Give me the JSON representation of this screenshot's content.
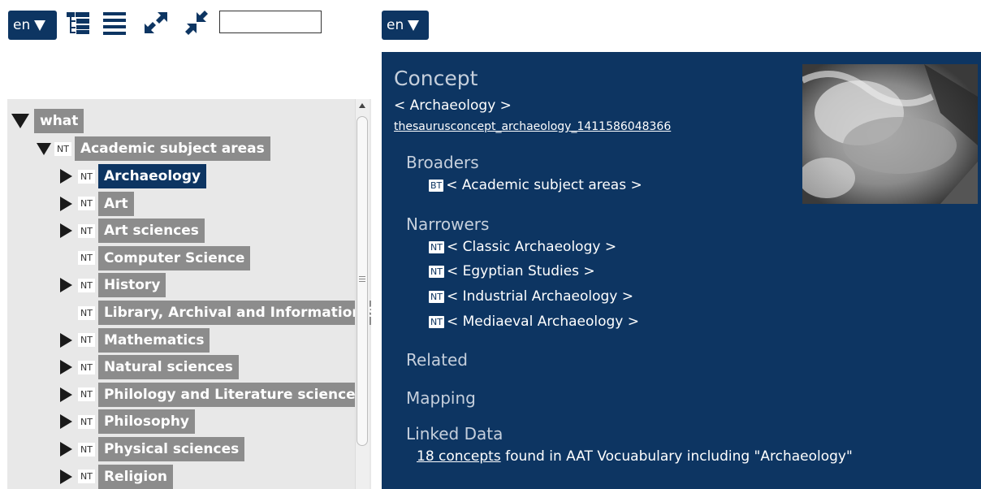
{
  "left_toolbar": {
    "lang": "en",
    "icons": [
      "tree-view-icon",
      "list-view-icon",
      "expand-all-icon",
      "collapse-all-icon"
    ],
    "search": {
      "value": "",
      "placeholder": ""
    }
  },
  "right_toolbar": {
    "lang": "en"
  },
  "tree": {
    "root": "what",
    "level1": {
      "tag": "NT",
      "label": "Academic subject areas"
    },
    "items": [
      {
        "tag": "NT",
        "label": "Archaeology",
        "expandable": true,
        "selected": true
      },
      {
        "tag": "NT",
        "label": "Art",
        "expandable": true
      },
      {
        "tag": "NT",
        "label": "Art sciences",
        "expandable": true
      },
      {
        "tag": "NT",
        "label": "Computer Science",
        "expandable": false
      },
      {
        "tag": "NT",
        "label": "History",
        "expandable": true
      },
      {
        "tag": "NT",
        "label": "Library, Archival and Information Sciences",
        "expandable": false
      },
      {
        "tag": "NT",
        "label": "Mathematics",
        "expandable": true
      },
      {
        "tag": "NT",
        "label": "Natural sciences",
        "expandable": true
      },
      {
        "tag": "NT",
        "label": "Philology and Literature sciences",
        "expandable": true
      },
      {
        "tag": "NT",
        "label": "Philosophy",
        "expandable": true
      },
      {
        "tag": "NT",
        "label": "Physical sciences",
        "expandable": true
      },
      {
        "tag": "NT",
        "label": "Religion",
        "expandable": true
      }
    ]
  },
  "detail": {
    "title": "Concept",
    "name": "< Archaeology >",
    "uri": "thesaurusconcept_archaeology_1411586048366",
    "broaders_heading": "Broaders",
    "broaders": [
      {
        "tag": "BT",
        "label": "< Academic subject areas >"
      }
    ],
    "narrowers_heading": "Narrowers",
    "narrowers": [
      {
        "tag": "NT",
        "label": "< Classic Archaeology >"
      },
      {
        "tag": "NT",
        "label": "< Egyptian Studies >"
      },
      {
        "tag": "NT",
        "label": "< Industrial Archaeology >"
      },
      {
        "tag": "NT",
        "label": "< Mediaeval Archaeology >"
      }
    ],
    "related_heading": "Related",
    "mapping_heading": "Mapping",
    "linked_heading": "Linked Data",
    "linked_link": "18 concepts",
    "linked_text": " found in AAT Vocuabulary including \"Archaeology\""
  },
  "colors": {
    "navy": "#0d3562",
    "node_gray": "#8c8c8c",
    "panel_gray": "#e8e8e8",
    "heading": "#c5cfdc"
  }
}
